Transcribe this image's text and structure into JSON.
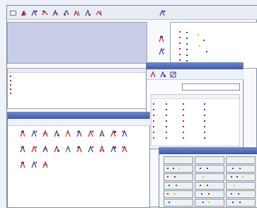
{
  "app": {
    "title": "",
    "toolbar_icons": [
      "app-icon",
      "toolbar-icon-1",
      "toolbar-icon-2",
      "toolbar-icon-3",
      "toolbar-icon-4",
      "toolbar-icon-5",
      "toolbar-icon-6",
      "toolbar-icon-7",
      "toolbar-icon-8",
      "toolbar-icon-9"
    ]
  },
  "panels": {
    "top_left": {
      "header": "",
      "list": []
    },
    "top_right": {
      "header": "",
      "items": []
    },
    "middle_left": {
      "header": "",
      "items": []
    },
    "popup": {
      "title": "",
      "filter_label": "",
      "rows": []
    },
    "bottom_left": {
      "title": "",
      "symbols": []
    },
    "bottom_right": {
      "title": ""
    }
  },
  "colors": {
    "desktop_bg": "#eef1f7",
    "window_border": "#7e8aa6",
    "selection_blue": "#c9cde8",
    "title_blue": "#3f5aa8",
    "accent_red": "#c61b2a",
    "accent_blue": "#2a3fa8",
    "accent_yellow": "#d7c800"
  }
}
